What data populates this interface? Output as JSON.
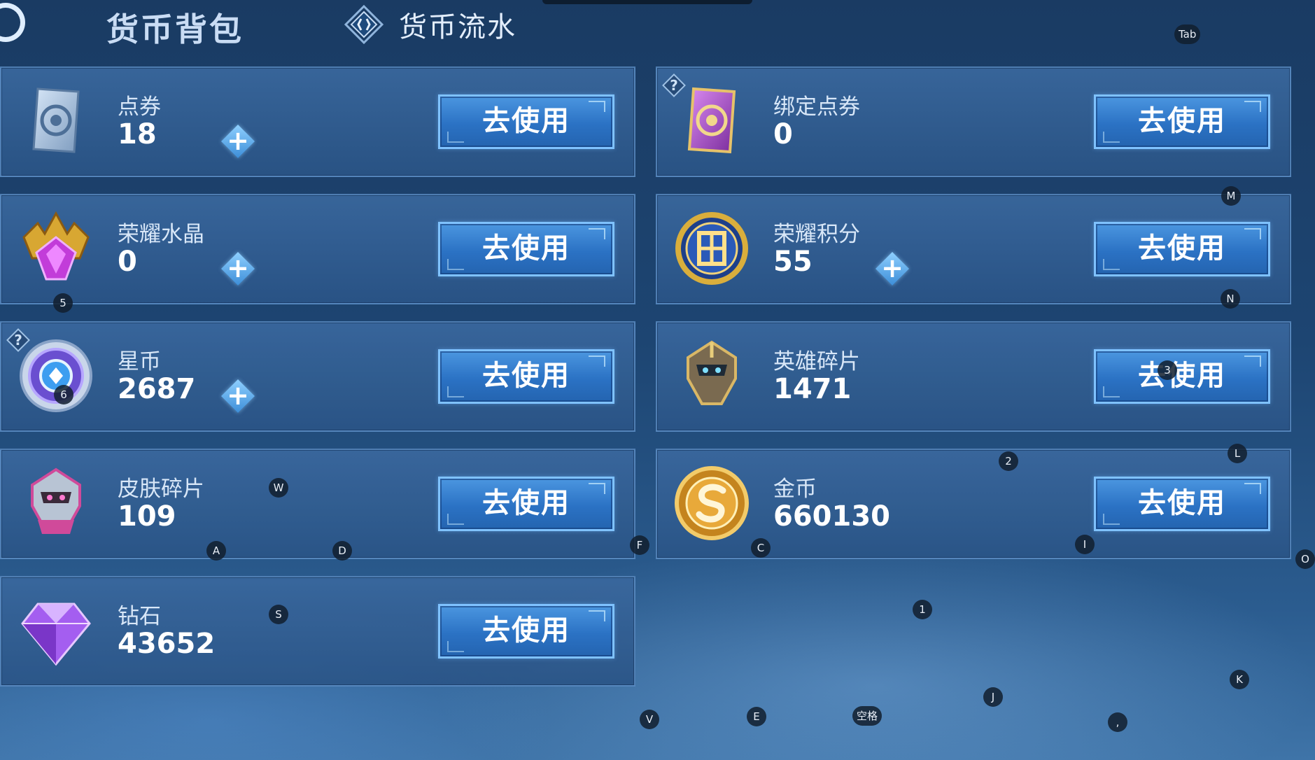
{
  "header": {
    "title": "货币背包",
    "flow_tab_label": "货币流水"
  },
  "cards": [
    {
      "name": "点券",
      "amount": "18",
      "button": "去使用"
    },
    {
      "name": "绑定点券",
      "amount": "0",
      "button": "去使用"
    },
    {
      "name": "荣耀水晶",
      "amount": "0",
      "button": "去使用"
    },
    {
      "name": "荣耀积分",
      "amount": "55",
      "button": "去使用"
    },
    {
      "name": "星币",
      "amount": "2687",
      "button": "去使用"
    },
    {
      "name": "英雄碎片",
      "amount": "1471",
      "button": "去使用"
    },
    {
      "name": "皮肤碎片",
      "amount": "109",
      "button": "去使用"
    },
    {
      "name": "金币",
      "amount": "660130",
      "button": "去使用"
    },
    {
      "name": "钻石",
      "amount": "43652",
      "button": "去使用"
    }
  ],
  "help_mark": "?",
  "plus_mark": "+",
  "key_hints": {
    "tab": "Tab",
    "m": "M",
    "n": "N",
    "l": "L",
    "o": "O",
    "k": "K",
    "i": "I",
    "c": "C",
    "f": "F",
    "w": "W",
    "a": "A",
    "d": "D",
    "s": "S",
    "v": "V",
    "e": "E",
    "space": "空格",
    "j": "J",
    "comma": ",",
    "k1": "1",
    "k2": "2",
    "k3": "3",
    "k5": "5",
    "k6": "6"
  },
  "colors": {
    "button_fill": "#2b72c4",
    "button_border": "#7fc2ff",
    "card_fill": "#3a689e",
    "plus_fill": "#3d8ed8"
  },
  "icons": {
    "back": "back-arrow-icon",
    "flow": "currency-flow-icon",
    "dianquan": "coupon-card-icon",
    "bound": "bound-coupon-card-icon",
    "crystal": "glory-crystal-icon",
    "points": "glory-points-icon",
    "star": "star-coin-icon",
    "hero": "hero-fragment-icon",
    "skin": "skin-fragment-icon",
    "gold": "gold-coin-icon",
    "diamond": "diamond-icon"
  }
}
